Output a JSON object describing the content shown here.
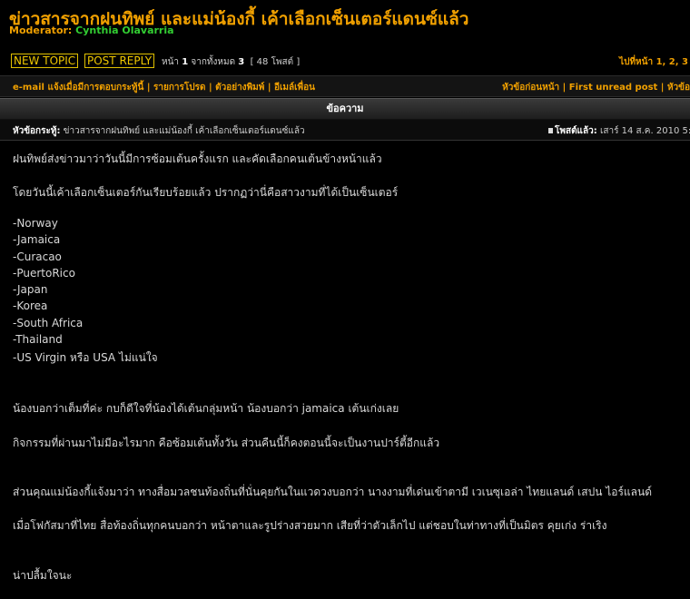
{
  "topic": {
    "title": "ข่าวสารจากฝนทิพย์ และแม่น้องกี้ เค้าเลือกเซ็นเตอร์แดนซ์แล้ว",
    "moderator_label": "Moderator:",
    "moderator_name": "Cynthia Olavarria"
  },
  "toolbar": {
    "new_topic": "NEW TOPIC",
    "post_reply": "POST REPLY",
    "page_label": "หน้า",
    "page_current": "1",
    "page_of": "จากทั้งหมด",
    "page_total": "3",
    "post_count": "[ 48 โพสต์ ]",
    "goto_label": "ไปที่หน้า",
    "goto_pages": "1, 2, 3"
  },
  "links": {
    "notify": "e-mail แจ้งเมื่อมีการตอบกระทู้นี้",
    "bookmark": "รายการโปรด",
    "print": "ตัวอย่างพิมพ์",
    "email_friend": "อีเมล์เพื่อน",
    "prev_topic": "หัวข้อก่อนหน้า",
    "first_unread": "First unread post",
    "next_topic": "หัวข้อ"
  },
  "table": {
    "header": "ข้อความ"
  },
  "post": {
    "subject_label": "หัวข้อกระทู้:",
    "subject": "ข่าวสารจากฝนทิพย์ และแม่น้องกี้ เค้าเลือกเซ็นเตอร์แดนซ์แล้ว",
    "posted_label": "โพสต์แล้ว:",
    "posted_date": "เสาร์ 14 ส.ค. 2010 5:",
    "lines": [
      "ฝนทิพย์ส่งข่าวมาว่าวันนี้มีการซ้อมเต้นครั้งแรก และคัดเลือกคนเต้นข้างหน้าแล้ว",
      "โดยวันนี้เค้าเลือกเซ็นเตอร์กันเรียบร้อยแล้ว ปรากฏว่านี่คือสาวงามที่ได้เป็นเซ็นเตอร์",
      "-Norway",
      "-Jamaica",
      "-Curacao",
      "-PuertoRico",
      "-Japan",
      "-Korea",
      "-South Africa",
      "-Thailand",
      "-US Virgin หรือ USA ไม่แน่ใจ",
      "น้องบอกว่าเต็มที่ค่ะ กบก็ดีใจที่น้องได้เต้นกลุ่มหน้า น้องบอกว่า jamaica เต้นเก่งเลย",
      "กิจกรรมที่ผ่านมาไม่มีอะไรมาก คือซ้อมเต้นทั้งวัน ส่วนคืนนี้ก็คงตอนนี้จะเป็นงานปาร์ตี้อีกแล้ว",
      "ส่วนคุณแม่น้องกี้แจ้งมาว่า ทางสื่อมวลชนท้องถิ่นที่นั่นคุยกันในแวดวงบอกว่า นางงามที่เด่นเข้าตามี เวเนซุเอล่า ไทยแลนด์ เสปน ไอร์แลนด์",
      "เมื่อโฟกัสมาที่ไทย สื่อท้องถิ่นทุกคนบอกว่า หน้าตาและรูปร่างสวยมาก เสียที่ว่าตัวเล็กไป แต่ชอบในท่าทางที่เป็นมิตร คุยเก่ง ร่าเริง",
      "น่าปลื้มใจนะ"
    ]
  }
}
